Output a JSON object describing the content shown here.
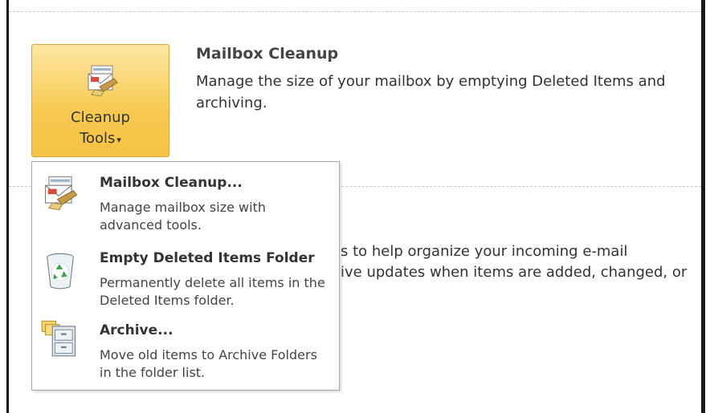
{
  "cleanup_button": {
    "line1": "Cleanup",
    "line2": "Tools",
    "arrow": "▾"
  },
  "section": {
    "title": "Mailbox Cleanup",
    "description": "Manage the size of your mailbox by emptying Deleted Items and archiving."
  },
  "rules_section": {
    "line1": "s to help organize your incoming e-mail",
    "line2": "ive updates when items are added, changed, or"
  },
  "menu": {
    "items": [
      {
        "title": "Mailbox Cleanup...",
        "description": "Manage mailbox size with advanced tools.",
        "icon": "mailbox-cleanup-icon"
      },
      {
        "title": "Empty Deleted Items Folder",
        "description": "Permanently delete all items in the Deleted Items folder.",
        "icon": "recycle-bin-icon"
      },
      {
        "title": "Archive...",
        "description": "Move old items to Archive Folders in the folder list.",
        "icon": "archive-cabinet-icon"
      }
    ]
  }
}
